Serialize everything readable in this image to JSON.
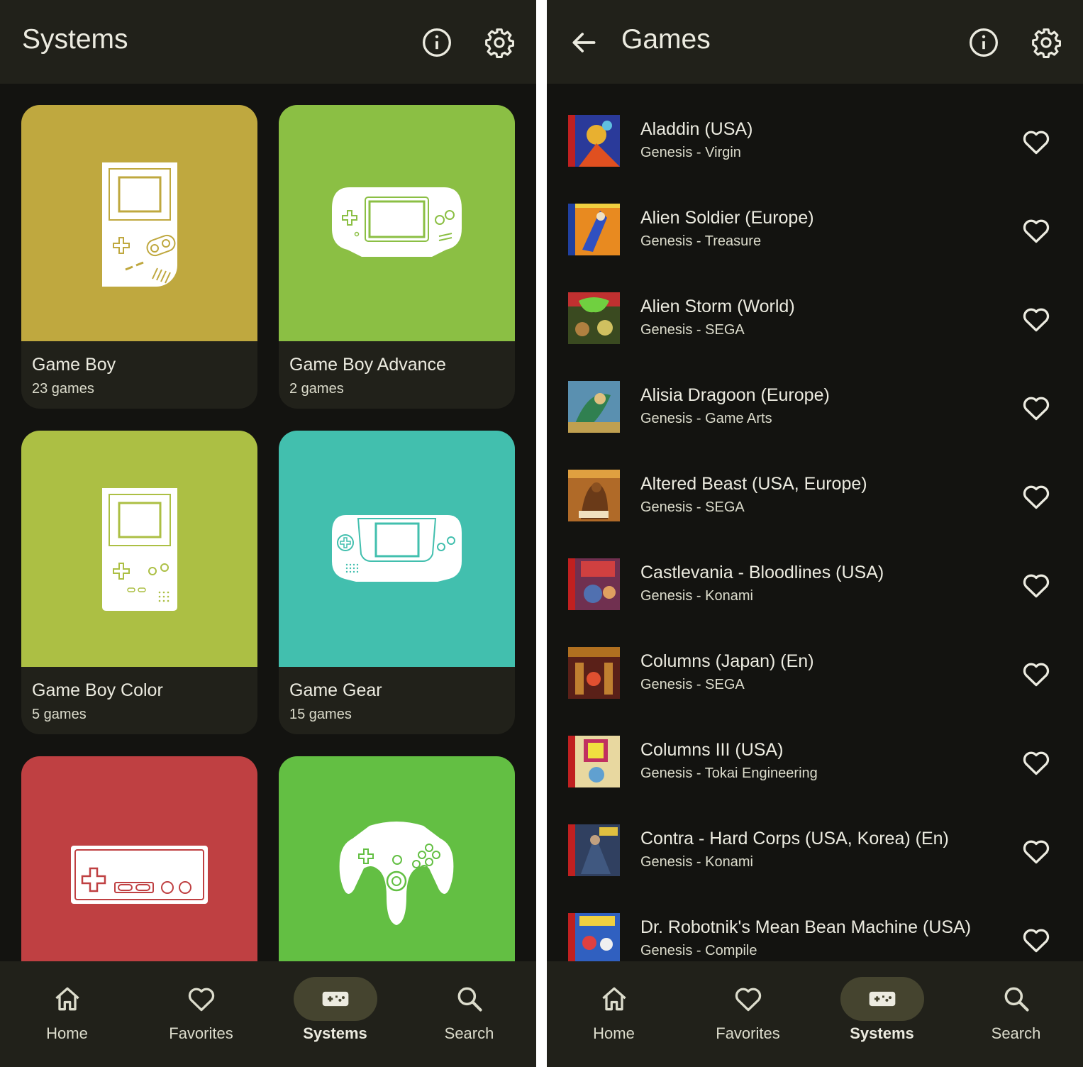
{
  "left_screen": {
    "title": "Systems",
    "info_icon": "info-icon",
    "settings_icon": "gear-icon",
    "systems": [
      {
        "name": "Game Boy",
        "count": "23 games",
        "color": "#bfa83f",
        "icon": "game-boy-icon"
      },
      {
        "name": "Game Boy Advance",
        "count": "2 games",
        "color": "#8bbf44",
        "icon": "game-boy-advance-icon"
      },
      {
        "name": "Game Boy Color",
        "count": "5 games",
        "color": "#acbf44",
        "icon": "game-boy-color-icon"
      },
      {
        "name": "Game Gear",
        "count": "15 games",
        "color": "#42bfae",
        "icon": "game-gear-icon"
      },
      {
        "name": "",
        "count": "",
        "color": "#bf4042",
        "icon": "nes-controller-icon"
      },
      {
        "name": "",
        "count": "",
        "color": "#63bf43",
        "icon": "n64-controller-icon"
      }
    ]
  },
  "right_screen": {
    "title": "Games",
    "back_icon": "arrow-back-icon",
    "info_icon": "info-icon",
    "settings_icon": "gear-icon",
    "games": [
      {
        "title": "Aladdin (USA)",
        "subtitle": "Genesis - Virgin"
      },
      {
        "title": "Alien Soldier (Europe)",
        "subtitle": "Genesis - Treasure"
      },
      {
        "title": "Alien Storm (World)",
        "subtitle": "Genesis - SEGA"
      },
      {
        "title": "Alisia Dragoon (Europe)",
        "subtitle": "Genesis - Game Arts"
      },
      {
        "title": "Altered Beast (USA, Europe)",
        "subtitle": "Genesis - SEGA"
      },
      {
        "title": "Castlevania - Bloodlines (USA)",
        "subtitle": "Genesis - Konami"
      },
      {
        "title": "Columns (Japan) (En)",
        "subtitle": "Genesis - SEGA"
      },
      {
        "title": "Columns III (USA)",
        "subtitle": "Genesis - Tokai Engineering"
      },
      {
        "title": "Contra - Hard Corps (USA, Korea) (En)",
        "subtitle": "Genesis - Konami"
      },
      {
        "title": "Dr. Robotnik's Mean Bean Machine (USA)",
        "subtitle": "Genesis - Compile"
      }
    ]
  },
  "nav": {
    "items": [
      {
        "label": "Home",
        "icon": "home-icon",
        "active": false
      },
      {
        "label": "Favorites",
        "icon": "heart-icon",
        "active": false
      },
      {
        "label": "Systems",
        "icon": "gamepad-icon",
        "active": true
      },
      {
        "label": "Search",
        "icon": "search-icon",
        "active": false
      }
    ]
  },
  "colors": {
    "background": "#131310",
    "surface": "#21211a",
    "active_pill": "#45442f",
    "text": "#ecebe0"
  }
}
